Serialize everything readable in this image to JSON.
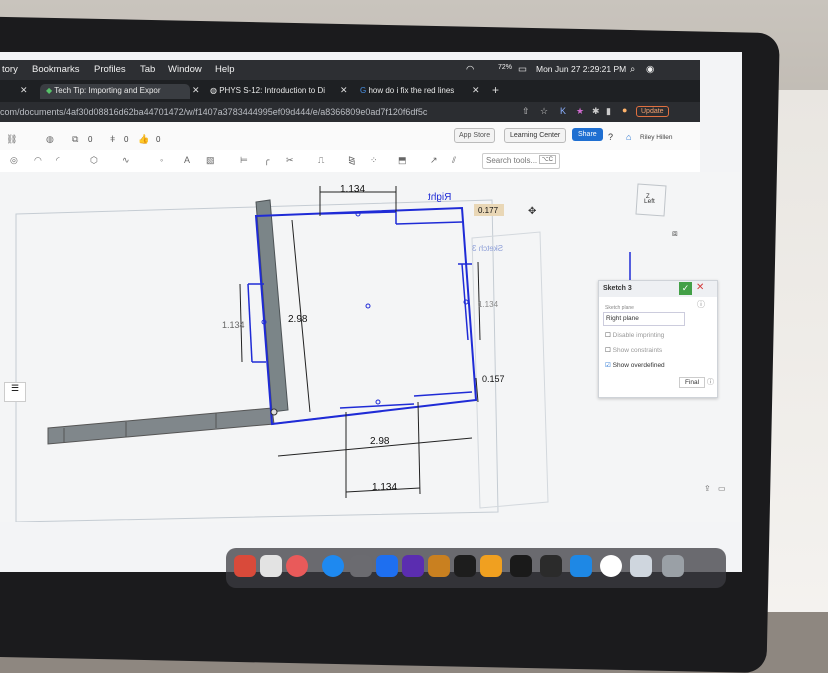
{
  "menubar": {
    "items": [
      "tory",
      "Bookmarks",
      "Profiles",
      "Tab",
      "Window",
      "Help"
    ],
    "battery": "72%",
    "clock": "Mon Jun 27  2:29:21 PM"
  },
  "tabs": [
    {
      "label": "Tech Tip: Importing and Expor",
      "active": true
    },
    {
      "label": "PHYS S-12: Introduction to Di",
      "active": false
    },
    {
      "label": "how do i fix the red lines",
      "active": false
    }
  ],
  "browser": {
    "url": "com/documents/4af30d08816d62ba44701472/w/f1407a3783444995ef09d444/e/a8366809e0ad7f120f6df5c",
    "update_label": "Update"
  },
  "app_header": {
    "stats": [
      "0",
      "0",
      "0"
    ],
    "app_store": "App Store",
    "learning_center": "Learning Center",
    "share": "Share",
    "user": "Riley Hillen"
  },
  "toolbar": {
    "search_placeholder": "Search tools...",
    "search_shortcut": "⌥C"
  },
  "sketch": {
    "plane_label": "Right",
    "sketch_label": "Sketch 3",
    "dim_top": "1.134",
    "dim_right_top": "0.177",
    "dim_left": "1.134",
    "dim_height": "2.98",
    "dim_right": "1.134",
    "dim_right_bottom": "0.157",
    "dim_width": "2.98",
    "dim_bottom": "1.134"
  },
  "viewcube": {
    "face": "Left",
    "axis": "Z"
  },
  "sketch_panel": {
    "title": "Sketch 3",
    "plane_caption": "Sketch plane",
    "plane_value": "Right plane",
    "options": [
      {
        "label": "Disable imprinting",
        "checked": false
      },
      {
        "label": "Show constraints",
        "checked": false
      },
      {
        "label": "Show overdefined",
        "checked": true
      }
    ],
    "final_label": "Final"
  },
  "colors": {
    "sketch_blue": "#1f2bd6",
    "part_gray": "#7f8a8f",
    "accept_green": "#43a047",
    "close_red": "#d33c3c",
    "share_blue": "#1f6fd1"
  }
}
